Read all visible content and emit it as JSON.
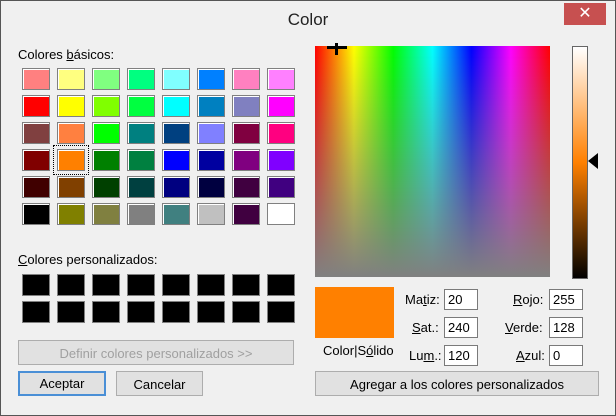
{
  "window": {
    "title": "Color",
    "close_glyph": "✕"
  },
  "basic_colors": {
    "label_pre": "Colores ",
    "label_ul": "b",
    "label_post": "ásicos:",
    "rows": [
      [
        "#ff8080",
        "#ffff80",
        "#80ff80",
        "#00ff80",
        "#80ffff",
        "#0080ff",
        "#ff80c0",
        "#ff80ff"
      ],
      [
        "#ff0000",
        "#ffff00",
        "#80ff00",
        "#00ff40",
        "#00ffff",
        "#0080c0",
        "#8080c0",
        "#ff00ff"
      ],
      [
        "#804040",
        "#ff8040",
        "#00ff00",
        "#008080",
        "#004080",
        "#8080ff",
        "#800040",
        "#ff0080"
      ],
      [
        "#800000",
        "#ff8000",
        "#008000",
        "#008040",
        "#0000ff",
        "#0000a0",
        "#800080",
        "#8000ff"
      ],
      [
        "#400000",
        "#804000",
        "#004000",
        "#004040",
        "#000080",
        "#000040",
        "#400040",
        "#400080"
      ],
      [
        "#000000",
        "#808000",
        "#808040",
        "#808080",
        "#408080",
        "#c0c0c0",
        "#400040",
        "#ffffff"
      ]
    ],
    "selected": [
      3,
      1
    ]
  },
  "custom_colors": {
    "label_pre": "",
    "label_ul": "C",
    "label_post": "olores personalizados:",
    "rows": [
      [
        "#000000",
        "#000000",
        "#000000",
        "#000000",
        "#000000",
        "#000000",
        "#000000",
        "#000000"
      ],
      [
        "#000000",
        "#000000",
        "#000000",
        "#000000",
        "#000000",
        "#000000",
        "#000000",
        "#000000"
      ]
    ]
  },
  "buttons": {
    "define_custom": "Definir colores personalizados >>",
    "accept": "Aceptar",
    "cancel": "Cancelar",
    "add_custom": "Agregar a los colores personalizados"
  },
  "preview": {
    "label_pre": "Color|S",
    "label_ul": "ó",
    "label_post": "lido",
    "color": "#ff8000"
  },
  "fields": {
    "hue": {
      "label_pre": "Ma",
      "label_ul": "t",
      "label_post": "iz:",
      "value": "20"
    },
    "sat": {
      "label_pre": "",
      "label_ul": "S",
      "label_post": "at.:",
      "value": "240"
    },
    "lum": {
      "label_pre": "Lu",
      "label_ul": "m",
      "label_post": ".:",
      "value": "120"
    },
    "red": {
      "label_pre": "",
      "label_ul": "R",
      "label_post": "ojo:",
      "value": "255"
    },
    "green": {
      "label_pre": "",
      "label_ul": "V",
      "label_post": "erde:",
      "value": "128"
    },
    "blue": {
      "label_pre": "",
      "label_ul": "A",
      "label_post": "zul:",
      "value": "0"
    }
  }
}
